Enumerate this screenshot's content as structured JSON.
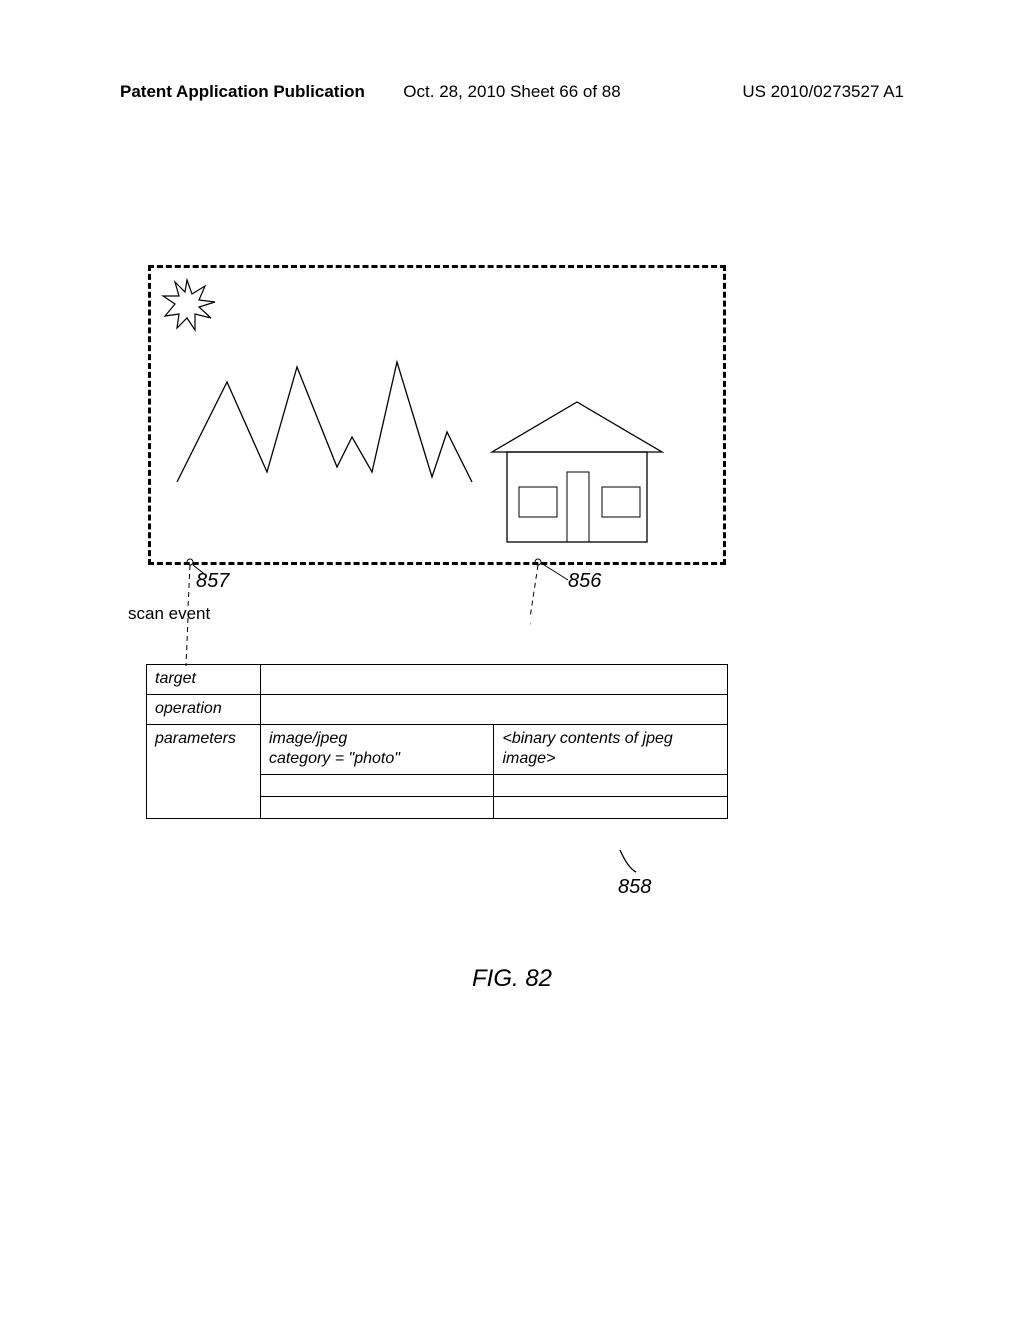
{
  "header": {
    "left": "Patent Application Publication",
    "center": "Oct. 28, 2010  Sheet 66 of 88",
    "right": "US 2010/0273527 A1"
  },
  "labels": {
    "scan_event": "scan event",
    "callout_857": "857",
    "callout_856": "856",
    "callout_858": "858"
  },
  "table": {
    "rows": [
      {
        "label": "target",
        "c2": "",
        "c3": ""
      },
      {
        "label": "operation",
        "c2": "",
        "c3": ""
      },
      {
        "label": "parameters",
        "c2": "image/jpeg\ncategory = \"photo\"",
        "c3": "<binary contents of jpeg image>"
      }
    ]
  },
  "figure_caption": "FIG. 82"
}
